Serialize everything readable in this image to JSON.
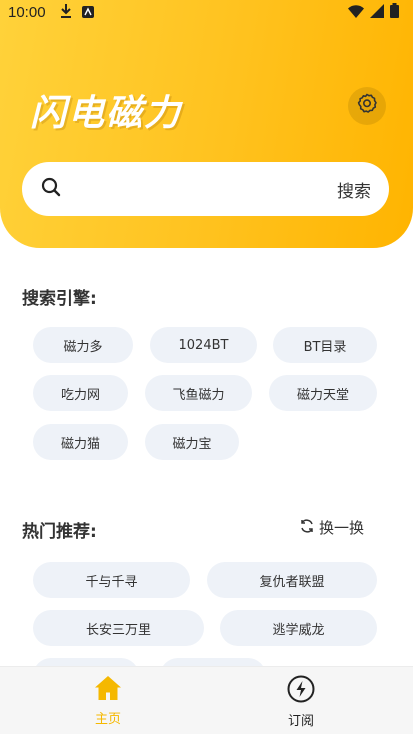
{
  "status_bar": {
    "time": "10:00"
  },
  "header": {
    "title": "闪电磁力"
  },
  "search": {
    "button_label": "搜索"
  },
  "engines": {
    "title": "搜索引擎:",
    "items": [
      "磁力多",
      "1024BT",
      "BT目录",
      "吃力网",
      "飞鱼磁力",
      "磁力天堂",
      "磁力猫",
      "磁力宝"
    ]
  },
  "hot": {
    "title": "热门推荐:",
    "refresh_label": "换一换",
    "items": [
      "千与千寻",
      "复仇者联盟",
      "长安三万里",
      "逃学威龙"
    ]
  },
  "nav": {
    "home_label": "主页",
    "subscribe_label": "订阅",
    "active_color": "#F5B800"
  }
}
